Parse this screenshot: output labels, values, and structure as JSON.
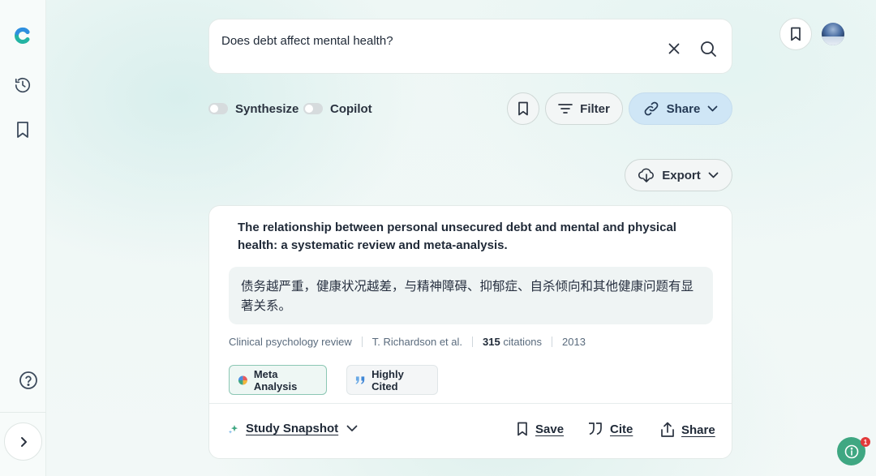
{
  "search": {
    "query": "Does debt affect mental health?"
  },
  "options": {
    "synthesize_label": "Synthesize",
    "copilot_label": "Copilot"
  },
  "toolbar": {
    "filter_label": "Filter",
    "share_label": "Share",
    "export_label": "Export"
  },
  "result": {
    "title": "The relationship between personal unsecured debt and mental and physical health: a systematic review and meta-analysis.",
    "summary": "债务越严重，健康状况越差，与精神障碍、抑郁症、自杀倾向和其他健康问题有显著关系。",
    "journal": "Clinical psychology review",
    "authors": "T. Richardson et al.",
    "citations_count": "315",
    "citations_label": "citations",
    "year": "2013",
    "tags": [
      "Meta Analysis",
      "Highly Cited"
    ],
    "actions": {
      "snapshot_label": "Study Snapshot",
      "save_label": "Save",
      "cite_label": "Cite",
      "share_label": "Share"
    }
  },
  "notifications": {
    "badge_count": "1"
  },
  "colors": {
    "brand": "#2bb5a0",
    "share_bg": "#cfe6f6",
    "fab": "#3fa782"
  }
}
